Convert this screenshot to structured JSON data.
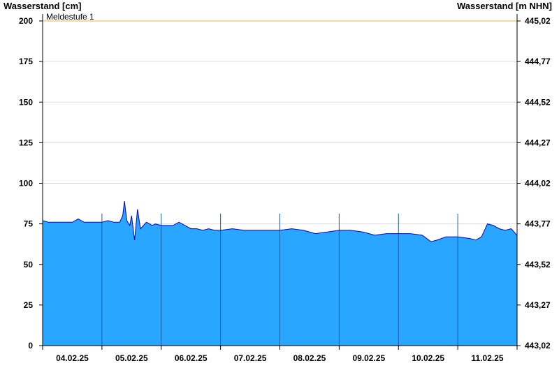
{
  "chart_data": {
    "type": "area",
    "left_axis": {
      "title": "Wasserstand [cm]",
      "ylim": [
        0,
        200
      ],
      "ticks": [
        0,
        25,
        50,
        75,
        100,
        125,
        150,
        175,
        200
      ],
      "tick_labels": [
        "0",
        "25",
        "50",
        "75",
        "100",
        "125",
        "150",
        "175",
        "200"
      ]
    },
    "right_axis": {
      "title": "Wasserstand [m NHN]",
      "ylim": [
        443.02,
        445.02
      ],
      "tick_labels": [
        "443,02",
        "443,27",
        "443,52",
        "443,77",
        "444,02",
        "444,27",
        "444,52",
        "444,77",
        "445,02"
      ]
    },
    "x_axis": {
      "range_days": [
        0,
        8
      ],
      "tick_labels": [
        "04.02.25",
        "05.02.25",
        "06.02.25",
        "07.02.25",
        "08.02.25",
        "09.02.25",
        "10.02.25",
        "11.02.25"
      ]
    },
    "grid": true,
    "threshold": {
      "label": "Meldestufe 1",
      "value": 200,
      "color": "#f5b041"
    },
    "fill_color": "#29a6ff",
    "line_color": "#0000cc",
    "series": [
      {
        "x": [
          0,
          0.1,
          0.2,
          0.35,
          0.5,
          0.6,
          0.7,
          0.8,
          0.9,
          1.0,
          1.1,
          1.2,
          1.3,
          1.35,
          1.38,
          1.42,
          1.47,
          1.5,
          1.55,
          1.6,
          1.65,
          1.7,
          1.75,
          1.8,
          1.85,
          1.9,
          2.0,
          2.1,
          2.2,
          2.3,
          2.4,
          2.5,
          2.6,
          2.7,
          2.8,
          2.9,
          3.0,
          3.2,
          3.4,
          3.6,
          3.8,
          4.0,
          4.2,
          4.4,
          4.6,
          4.8,
          5.0,
          5.2,
          5.4,
          5.6,
          5.8,
          6.0,
          6.2,
          6.4,
          6.55,
          6.65,
          6.8,
          7.0,
          7.2,
          7.3,
          7.4,
          7.5,
          7.6,
          7.7,
          7.8,
          7.9,
          8.0
        ],
        "y": [
          77,
          76,
          76,
          76,
          76,
          78,
          76,
          76,
          76,
          76,
          77,
          76,
          76,
          80,
          89,
          77,
          74,
          80,
          65,
          84,
          72,
          74,
          76,
          75,
          74,
          75,
          74,
          74,
          74,
          76,
          74,
          72,
          72,
          71,
          72,
          71,
          71,
          72,
          71,
          71,
          71,
          71,
          72,
          71,
          69,
          70,
          71,
          71,
          70,
          68,
          69,
          69,
          69,
          68,
          64,
          65,
          67,
          67,
          66,
          65,
          67,
          75,
          74,
          72,
          71,
          72,
          68
        ]
      }
    ]
  }
}
